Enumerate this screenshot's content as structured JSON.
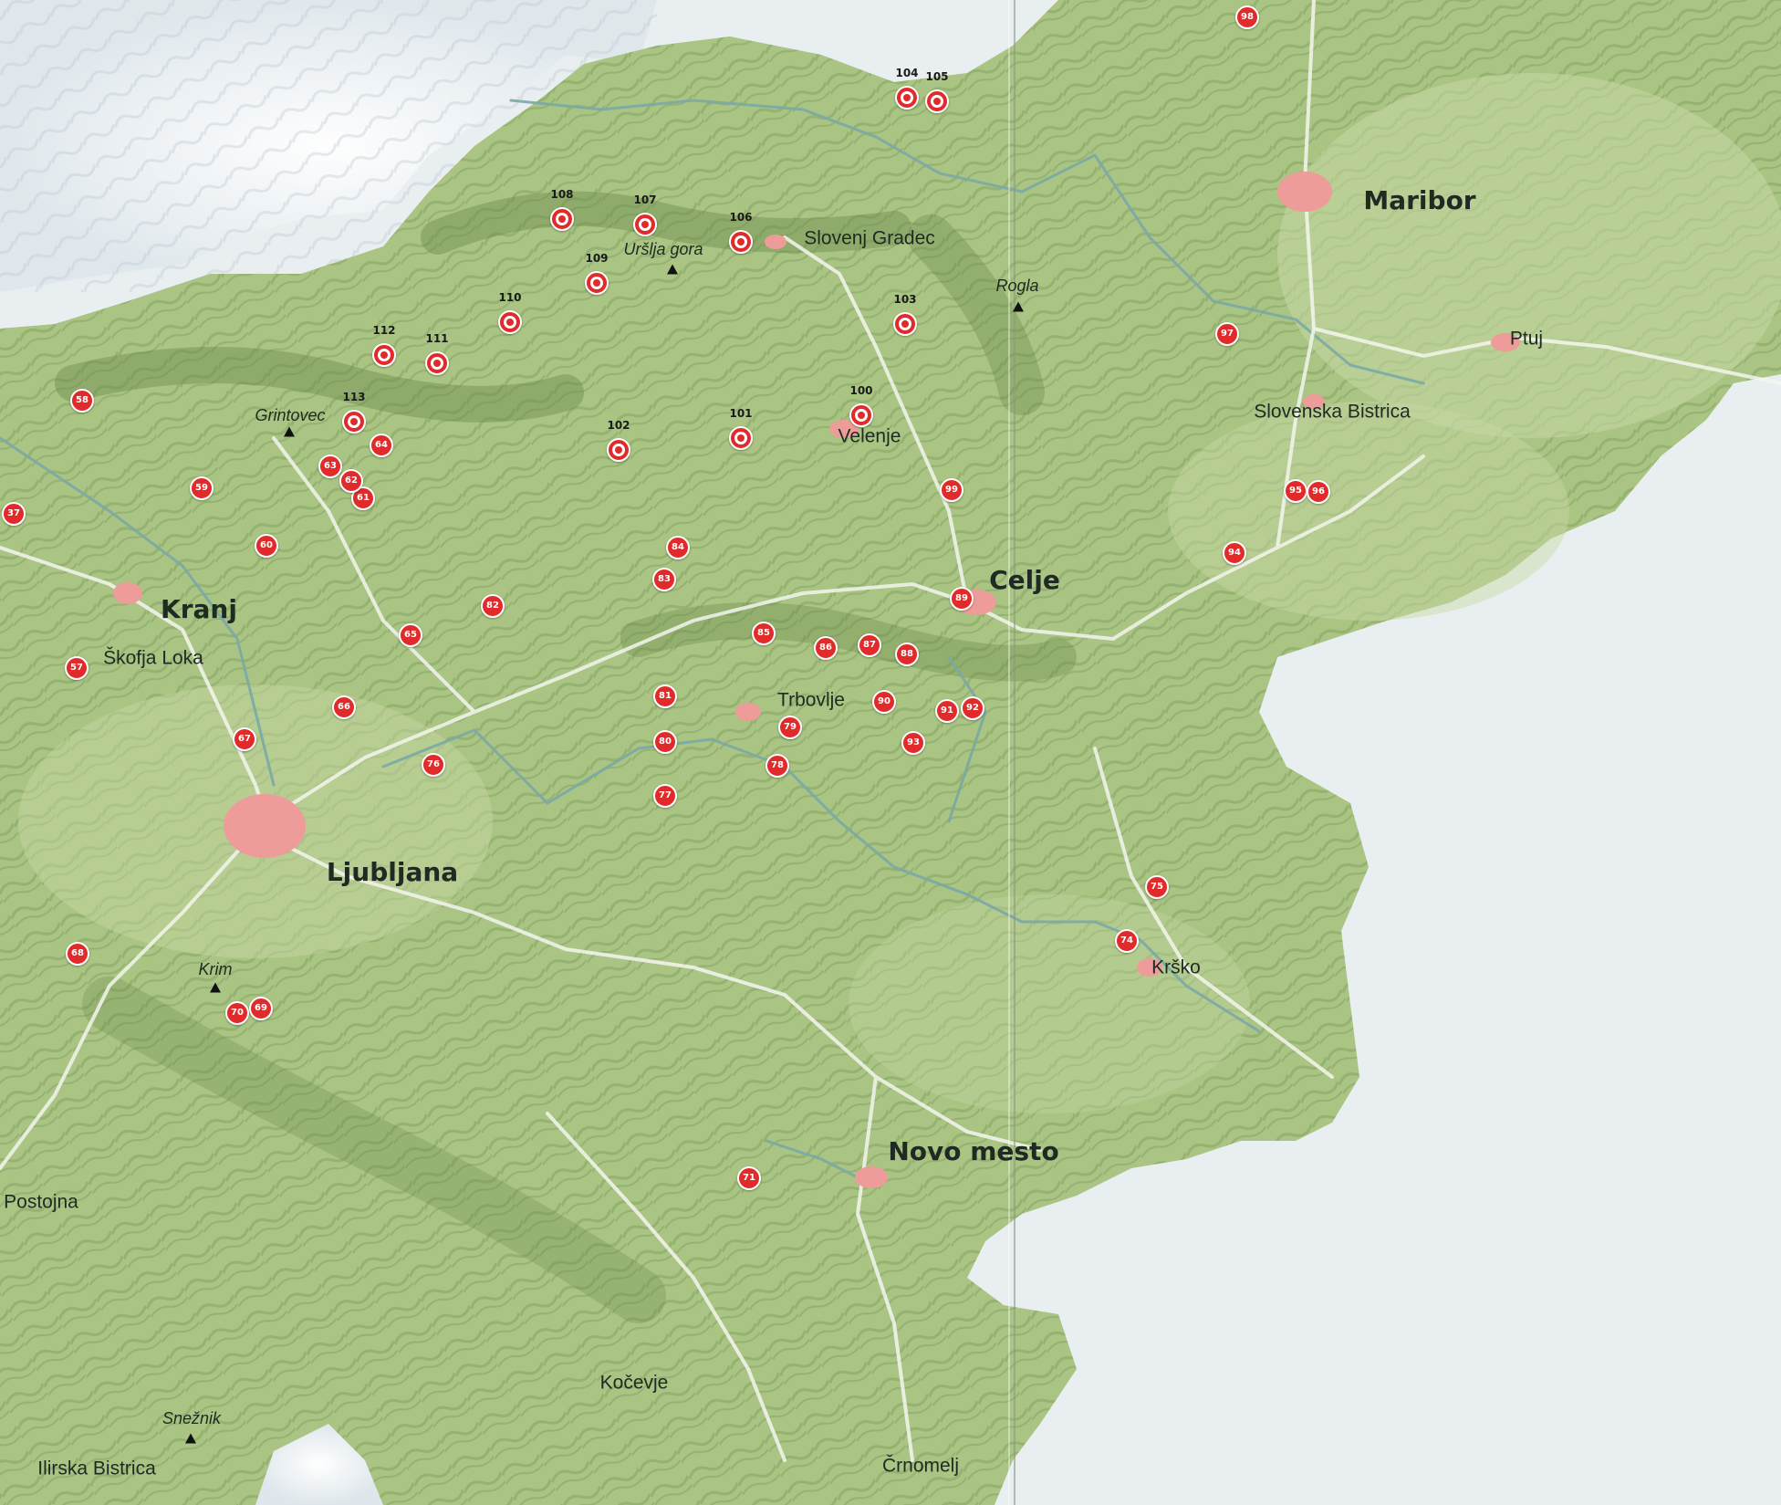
{
  "map": {
    "colors": {
      "land": "#a9c483",
      "land_light": "#c7d9a4",
      "ridge": "#6f8f4e",
      "outside": "#e9eef1",
      "road": "#f4f6ee",
      "river": "#7aa8a6",
      "urban": "#ee9c99",
      "marker": "#e12b2a"
    },
    "big_cities": [
      "Maribor",
      "Celje",
      "Kranj",
      "Ljubljana",
      "Novo mesto"
    ],
    "cities": [
      "Slovenj Gradec",
      "Velenje",
      "Ptuj",
      "Slovenska Bistrica",
      "Škofja Loka",
      "Trbovlje",
      "Krško",
      "Postojna",
      "Kočevje",
      "Ilirska Bistrica",
      "Črnomelj"
    ],
    "peaks": [
      "Uršlja gora",
      "Rogla",
      "Grintovec",
      "Krim",
      "Snežnik"
    ],
    "markers": [
      "37",
      "57",
      "58",
      "59",
      "60",
      "61",
      "62",
      "63",
      "64",
      "65",
      "66",
      "67",
      "68",
      "69",
      "70",
      "71",
      "74",
      "75",
      "76",
      "77",
      "78",
      "79",
      "80",
      "81",
      "82",
      "83",
      "84",
      "85",
      "86",
      "87",
      "88",
      "89",
      "90",
      "91",
      "92",
      "93",
      "94",
      "95",
      "96",
      "97",
      "98",
      "99"
    ],
    "targets": [
      "100",
      "101",
      "102",
      "103",
      "104",
      "105",
      "106",
      "107",
      "108",
      "109",
      "110",
      "111",
      "112",
      "113"
    ]
  }
}
